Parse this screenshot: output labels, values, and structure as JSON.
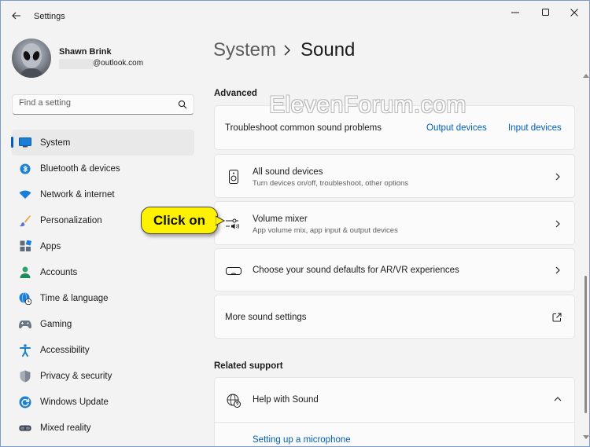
{
  "app": {
    "title": "Settings"
  },
  "user": {
    "name": "Shawn Brink",
    "email": "@outlook.com"
  },
  "search": {
    "placeholder": "Find a setting"
  },
  "nav": {
    "items": [
      {
        "label": "System",
        "icon": "monitor-icon",
        "active": true
      },
      {
        "label": "Bluetooth & devices",
        "icon": "bluetooth-icon"
      },
      {
        "label": "Network & internet",
        "icon": "wifi-icon"
      },
      {
        "label": "Personalization",
        "icon": "brush-icon"
      },
      {
        "label": "Apps",
        "icon": "apps-icon"
      },
      {
        "label": "Accounts",
        "icon": "person-icon"
      },
      {
        "label": "Time & language",
        "icon": "globe-clock-icon"
      },
      {
        "label": "Gaming",
        "icon": "gamepad-icon"
      },
      {
        "label": "Accessibility",
        "icon": "accessibility-icon"
      },
      {
        "label": "Privacy & security",
        "icon": "shield-icon"
      },
      {
        "label": "Windows Update",
        "icon": "update-icon"
      },
      {
        "label": "Mixed reality",
        "icon": "headset-icon"
      }
    ]
  },
  "breadcrumb": {
    "parent": "System",
    "current": "Sound"
  },
  "advanced": {
    "title": "Advanced",
    "troubleshoot": {
      "label": "Troubleshoot common sound problems",
      "output_link": "Output devices",
      "input_link": "Input devices"
    },
    "all_devices": {
      "title": "All sound devices",
      "subtitle": "Turn devices on/off, troubleshoot, other options"
    },
    "volume_mixer": {
      "title": "Volume mixer",
      "subtitle": "App volume mix, app input & output devices"
    },
    "arvr": {
      "title": "Choose your sound defaults for AR/VR experiences"
    },
    "more": {
      "title": "More sound settings"
    }
  },
  "related": {
    "title": "Related support",
    "help": {
      "title": "Help with Sound"
    },
    "link": "Setting up a microphone"
  },
  "watermark": "ElevenForum.com",
  "callout": "Click on",
  "colors": {
    "accent": "#005fb8",
    "callout": "#fff200"
  }
}
